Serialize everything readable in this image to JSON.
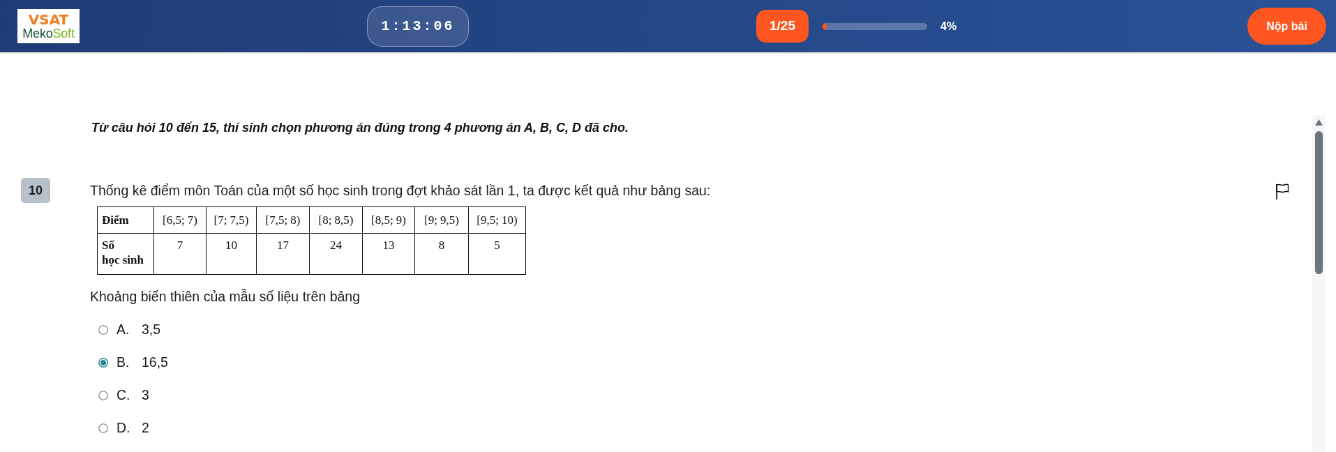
{
  "header": {
    "logo": {
      "title": "VSAT",
      "subtitle": [
        {
          "text": "Meko",
          "color": "#17503a"
        },
        {
          "text": "Soft",
          "color": "#77b51f"
        }
      ]
    },
    "timer": "1:13:06",
    "progress": {
      "counter": "1/25",
      "level": 0.04,
      "percent": "4%"
    },
    "submit_button": "Nộp bài"
  },
  "instruction": "Từ câu hỏi 10 đến 15, thí sinh chọn phương án đúng trong 4 phương án A, B, C, D đã cho.",
  "question": {
    "number": "10",
    "flagged": false,
    "text": "Thống kê điểm môn Toán của một số học sinh trong đợt khảo sát lần 1, ta được kết quả như bảng sau:",
    "table": {
      "rows": [
        {
          "label": "Điểm",
          "cells": [
            "[6,5; 7)",
            "[7; 7,5)",
            "[7,5; 8)",
            "[8; 8,5)",
            "[8,5; 9)",
            "[9; 9,5)",
            "[9,5; 10)"
          ]
        },
        {
          "label": "Số\nhọc sinh",
          "cells": [
            "7",
            "10",
            "17",
            "24",
            "13",
            "8",
            "5"
          ]
        }
      ]
    },
    "prompt": "Khoảng biến thiên của mẫu số liệu trên bảng",
    "options": [
      {
        "letter": "A.",
        "text": "3,5",
        "selected": false
      },
      {
        "letter": "B.",
        "text": "16,5",
        "selected": true
      },
      {
        "letter": "C.",
        "text": "3",
        "selected": false
      },
      {
        "letter": "D.",
        "text": "2",
        "selected": false
      }
    ]
  }
}
